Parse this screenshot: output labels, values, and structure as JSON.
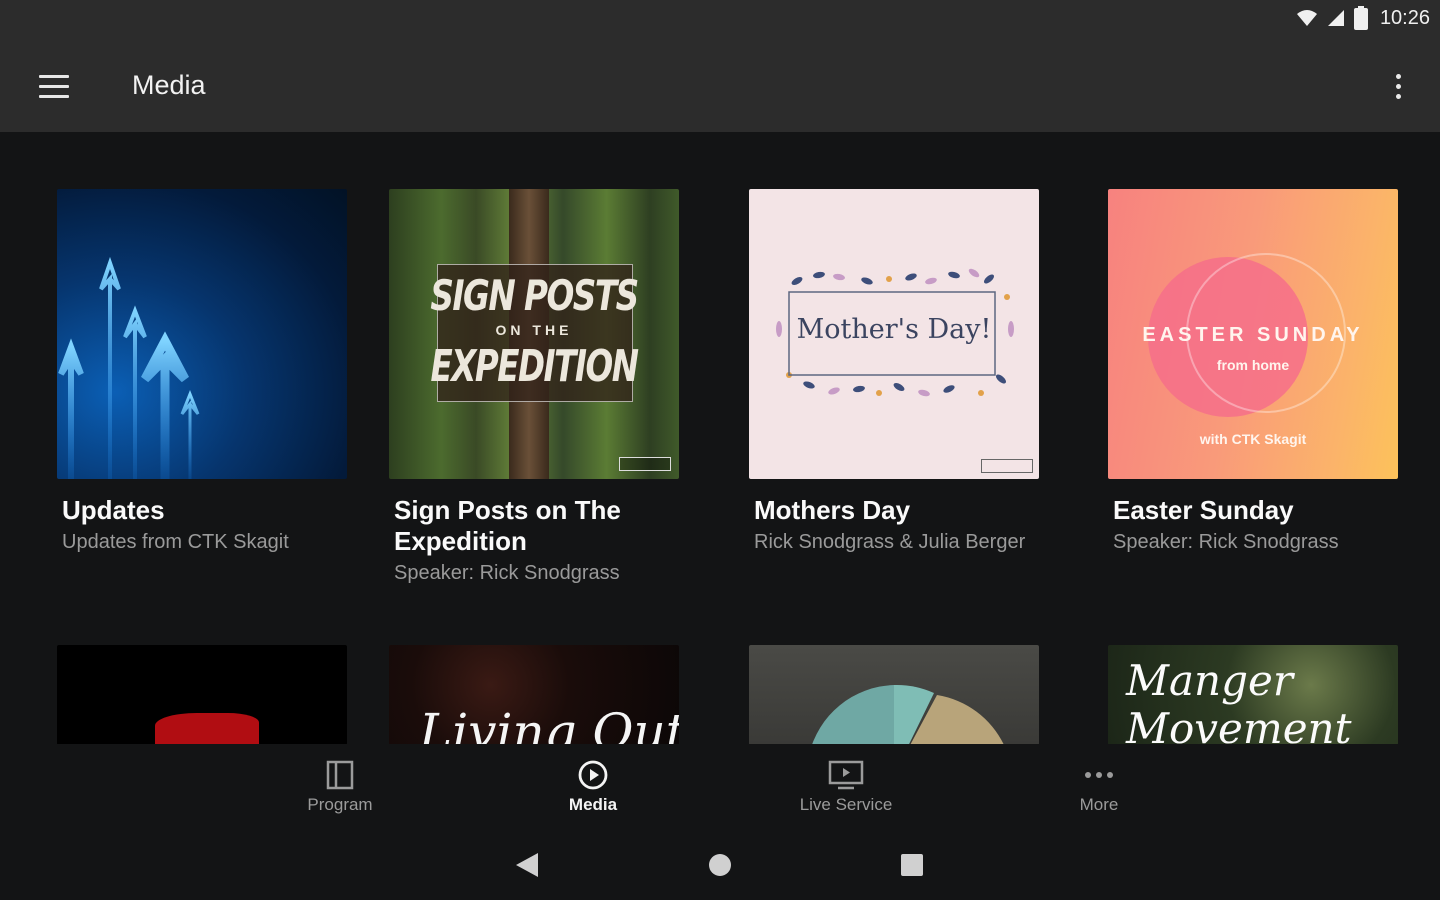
{
  "status_bar": {
    "time": "10:26"
  },
  "app_bar": {
    "title": "Media"
  },
  "colors": {
    "background": "#131415",
    "bar": "#2c2c2c",
    "text_primary": "#fafafa",
    "text_secondary": "#9a9a9a"
  },
  "cards": [
    {
      "title": "Updates",
      "subtitle": "Updates from CTK Skagit"
    },
    {
      "title": "Sign Posts on The Expedition",
      "subtitle": "Speaker: Rick Snodgrass",
      "art": {
        "line1": "SIGN POSTS",
        "line2": "ON THE",
        "line3": "EXPEDITION"
      }
    },
    {
      "title": "Mothers Day",
      "subtitle": "Rick Snodgrass & Julia Berger",
      "art": {
        "text": "Mother's Day!"
      }
    },
    {
      "title": "Easter Sunday",
      "subtitle": "Speaker: Rick Snodgrass",
      "art": {
        "line1": "EASTER SUNDAY",
        "line2": "from home",
        "line3": "with CTK Skagit"
      }
    }
  ],
  "cards_row2": [
    {
      "art_text": ""
    },
    {
      "art_text": "Living Out"
    },
    {
      "art_text": ""
    },
    {
      "art_text": "Manger Movement"
    }
  ],
  "bottom_nav": [
    {
      "label": "Program",
      "icon": "book-icon",
      "active": false
    },
    {
      "label": "Media",
      "icon": "play-circle-icon",
      "active": true
    },
    {
      "label": "Live Service",
      "icon": "tv-play-icon",
      "active": false
    },
    {
      "label": "More",
      "icon": "more-horizontal-icon",
      "active": false
    }
  ],
  "system_nav": {
    "back": "back-triangle-icon",
    "home": "home-circle-icon",
    "recents": "recents-square-icon"
  }
}
